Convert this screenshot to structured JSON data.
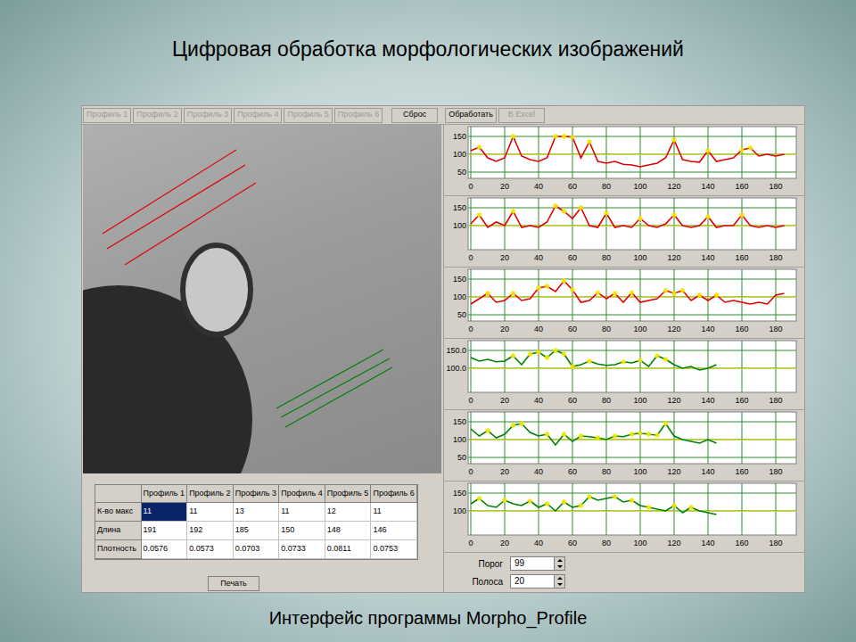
{
  "slide": {
    "title": "Цифровая обработка морфологических изображений",
    "caption": "Интерфейс программы Morpho_Profile"
  },
  "toolbar": [
    {
      "label": "Профиль 1",
      "disabled": true
    },
    {
      "label": "Профиль 2",
      "disabled": true
    },
    {
      "label": "Профиль 3",
      "disabled": true
    },
    {
      "label": "Профиль 4",
      "disabled": true
    },
    {
      "label": "Профиль 5",
      "disabled": true
    },
    {
      "label": "Профиль 6",
      "disabled": true
    },
    {
      "label": "Сброс",
      "disabled": false
    },
    {
      "label": "Обработать",
      "disabled": false
    },
    {
      "label": "В Excel",
      "disabled": true
    }
  ],
  "table": {
    "columns": [
      "",
      "Профиль 1",
      "Профиль 2",
      "Профиль 3",
      "Профиль 4",
      "Профиль 5",
      "Профиль 6"
    ],
    "rows": [
      {
        "label": "К-во макс",
        "cells": [
          {
            "text": "11",
            "selected": true
          },
          {
            "text": "11",
            "selected": false
          },
          {
            "text": "13",
            "selected": false
          },
          {
            "text": "11",
            "selected": false
          },
          {
            "text": "12",
            "selected": false
          },
          {
            "text": "11",
            "selected": false
          }
        ]
      },
      {
        "label": "Длина",
        "cells": [
          {
            "text": "191",
            "selected": false
          },
          {
            "text": "192",
            "selected": false
          },
          {
            "text": "185",
            "selected": false
          },
          {
            "text": "150",
            "selected": false
          },
          {
            "text": "148",
            "selected": false
          },
          {
            "text": "146",
            "selected": false
          }
        ]
      },
      {
        "label": "Плотность",
        "cells": [
          {
            "text": "0.0576",
            "selected": false
          },
          {
            "text": "0.0573",
            "selected": false
          },
          {
            "text": "0.0703",
            "selected": false
          },
          {
            "text": "0.0733",
            "selected": false
          },
          {
            "text": "0.0811",
            "selected": false
          },
          {
            "text": "0.0753",
            "selected": false
          }
        ]
      }
    ]
  },
  "print_button": "Печать",
  "charts": [
    {
      "color": "#e00000",
      "y_ticks": [
        "150",
        "100",
        "50"
      ],
      "x_ticks": [
        "0",
        "20",
        "40",
        "60",
        "80",
        "100",
        "120",
        "140",
        "160",
        "180"
      ],
      "step": 5,
      "values": [
        110,
        120,
        90,
        80,
        90,
        150,
        95,
        85,
        80,
        90,
        150,
        150,
        148,
        90,
        135,
        80,
        75,
        80,
        72,
        70,
        65,
        70,
        75,
        90,
        140,
        85,
        80,
        78,
        110,
        80,
        85,
        90,
        112,
        118,
        95,
        100,
        95,
        100
      ],
      "peaks": [
        5,
        25,
        50,
        55,
        60,
        70,
        120,
        140,
        160,
        165
      ]
    },
    {
      "color": "#e00000",
      "y_ticks": [
        "150",
        "100"
      ],
      "x_ticks": [
        "0",
        "20",
        "40",
        "60",
        "80",
        "100",
        "120",
        "140",
        "160",
        "180"
      ],
      "step": 5,
      "values": [
        105,
        130,
        95,
        110,
        100,
        140,
        95,
        100,
        95,
        110,
        155,
        140,
        120,
        150,
        100,
        95,
        135,
        95,
        100,
        95,
        120,
        100,
        95,
        105,
        130,
        100,
        95,
        100,
        125,
        95,
        100,
        100,
        130,
        100,
        95,
        100,
        95,
        100
      ],
      "peaks": [
        5,
        25,
        50,
        55,
        65,
        80,
        100,
        120,
        140,
        160
      ]
    },
    {
      "color": "#e00000",
      "y_ticks": [
        "150",
        "100",
        "50"
      ],
      "x_ticks": [
        "0",
        "20",
        "40",
        "60",
        "80",
        "100",
        "120",
        "140",
        "160",
        "180"
      ],
      "step": 5,
      "values": [
        80,
        95,
        110,
        85,
        90,
        110,
        90,
        95,
        125,
        130,
        115,
        145,
        120,
        85,
        90,
        112,
        95,
        110,
        85,
        112,
        85,
        90,
        95,
        118,
        110,
        118,
        90,
        105,
        90,
        105,
        85,
        90,
        85,
        80,
        85,
        80,
        105,
        110
      ],
      "peaks": [
        10,
        25,
        40,
        45,
        55,
        60,
        75,
        85,
        95,
        115,
        120,
        125,
        135,
        145
      ]
    },
    {
      "color": "#008000",
      "y_ticks": [
        "150.0",
        "100.0"
      ],
      "x_ticks": [
        "0",
        "20",
        "40",
        "60",
        "80",
        "100",
        "120",
        "140",
        "160",
        "180"
      ],
      "step": 5,
      "values": [
        130,
        120,
        125,
        118,
        120,
        135,
        110,
        140,
        145,
        130,
        150,
        140,
        105,
        110,
        120,
        112,
        108,
        110,
        118,
        115,
        122,
        105,
        135,
        125,
        110,
        100,
        105,
        95,
        100,
        110
      ],
      "peaks": [
        25,
        35,
        40,
        45,
        50,
        55,
        60,
        70,
        90,
        100,
        110,
        115
      ]
    },
    {
      "color": "#008000",
      "y_ticks": [
        "150",
        "100",
        "50"
      ],
      "x_ticks": [
        "0",
        "20",
        "40",
        "60",
        "80",
        "100",
        "120",
        "140",
        "160",
        "180"
      ],
      "step": 5,
      "values": [
        130,
        110,
        125,
        105,
        115,
        140,
        145,
        120,
        110,
        115,
        85,
        115,
        95,
        110,
        108,
        105,
        100,
        110,
        108,
        115,
        118,
        115,
        112,
        145,
        110,
        100,
        95,
        90,
        100,
        90
      ],
      "peaks": [
        10,
        25,
        30,
        45,
        55,
        65,
        75,
        85,
        95,
        100,
        105,
        110,
        115
      ]
    },
    {
      "color": "#008000",
      "y_ticks": [
        "150",
        "100"
      ],
      "x_ticks": [
        "0",
        "20",
        "40",
        "60",
        "80",
        "100",
        "120",
        "140",
        "160",
        "180"
      ],
      "step": 5,
      "values": [
        120,
        135,
        115,
        110,
        130,
        120,
        115,
        128,
        110,
        120,
        100,
        125,
        110,
        115,
        140,
        130,
        135,
        140,
        125,
        130,
        115,
        110,
        105,
        100,
        115,
        95,
        110,
        100,
        95,
        90
      ],
      "peaks": [
        5,
        20,
        35,
        45,
        55,
        65,
        70,
        85,
        95,
        105,
        120,
        130
      ]
    }
  ],
  "controls": [
    {
      "label": "Порог",
      "value": "99"
    },
    {
      "label": "Полоса",
      "value": "20"
    }
  ]
}
